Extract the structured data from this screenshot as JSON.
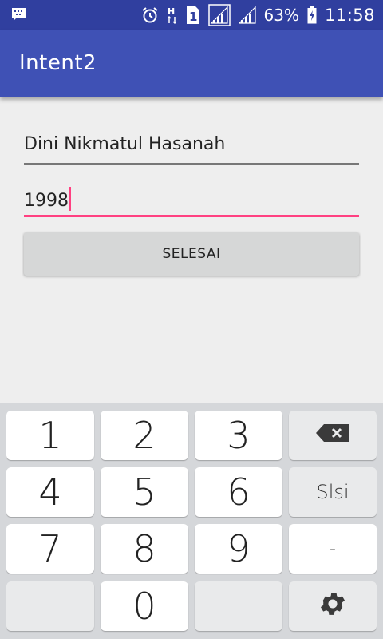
{
  "status_bar": {
    "left_icon": "bbm-chat-icon",
    "icons": [
      "alarm-clock-icon",
      "h-network-icon",
      "sim-1-icon",
      "signal-icon",
      "signal-icon-2",
      "battery-charging-icon"
    ],
    "battery_percent": "63%",
    "time": "11:58"
  },
  "app_bar": {
    "title": "Intent2"
  },
  "form": {
    "name_value": "Dini Nikmatul Hasanah",
    "year_value": "1998",
    "submit_label": "SELESAI"
  },
  "keyboard": {
    "keys": {
      "k1": "1",
      "k2": "2",
      "k3": "3",
      "k4": "4",
      "k5": "5",
      "k6": "6",
      "k7": "7",
      "k8": "8",
      "k9": "9",
      "k0": "0"
    },
    "done_label": "Slsi",
    "minus_label": "-",
    "backspace_icon": "backspace-icon",
    "settings_icon": "gear-icon"
  },
  "colors": {
    "status_bar": "#303f9f",
    "app_bar": "#3f51b5",
    "accent": "#ff4081",
    "button": "#d6d7d7",
    "keyboard_bg": "#d5d7da"
  }
}
